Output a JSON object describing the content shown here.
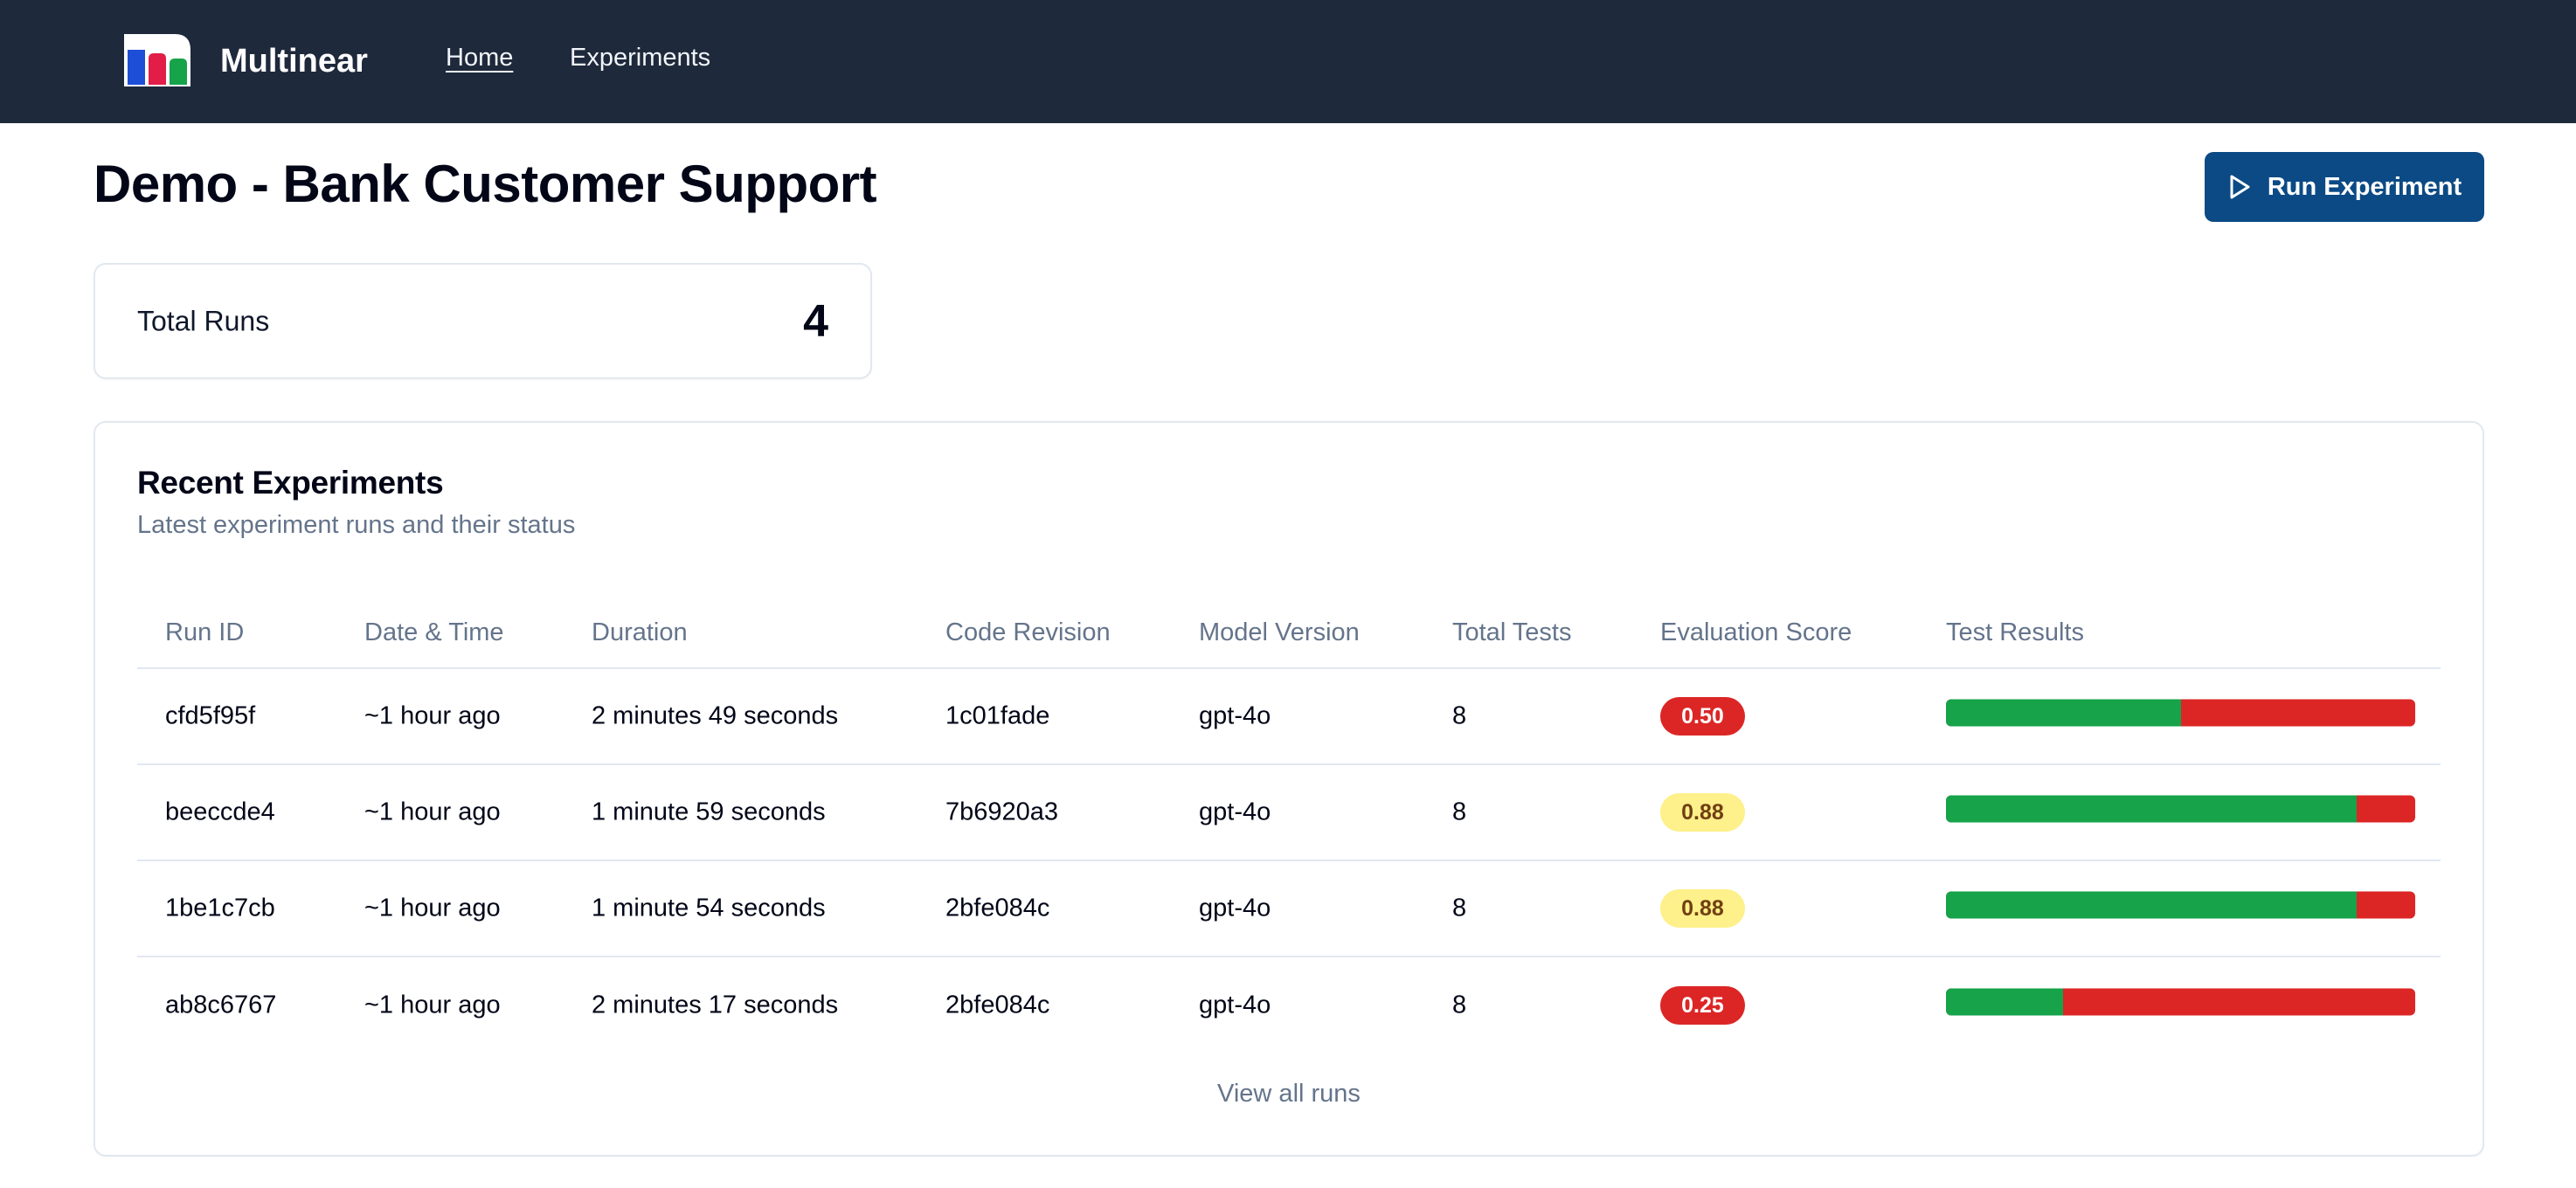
{
  "navbar": {
    "brand": "Multinear",
    "links": [
      {
        "label": "Home",
        "active": true
      },
      {
        "label": "Experiments",
        "active": false
      }
    ]
  },
  "page": {
    "title": "Demo - Bank Customer Support",
    "run_button": "Run Experiment"
  },
  "summary": {
    "total_runs_label": "Total Runs",
    "total_runs_value": "4"
  },
  "recent": {
    "title": "Recent Experiments",
    "subtitle": "Latest experiment runs and their status",
    "columns": [
      "Run ID",
      "Date & Time",
      "Duration",
      "Code Revision",
      "Model Version",
      "Total Tests",
      "Evaluation Score",
      "Test Results"
    ],
    "rows": [
      {
        "run_id": "cfd5f95f",
        "date": "~1 hour ago",
        "duration": "2 minutes 49 seconds",
        "revision": "1c01fade",
        "model": "gpt-4o",
        "total_tests": "8",
        "score": "0.50",
        "score_level": "red",
        "pass_fraction": 0.5
      },
      {
        "run_id": "beeccde4",
        "date": "~1 hour ago",
        "duration": "1 minute 59 seconds",
        "revision": "7b6920a3",
        "model": "gpt-4o",
        "total_tests": "8",
        "score": "0.88",
        "score_level": "yellow",
        "pass_fraction": 0.875
      },
      {
        "run_id": "1be1c7cb",
        "date": "~1 hour ago",
        "duration": "1 minute 54 seconds",
        "revision": "2bfe084c",
        "model": "gpt-4o",
        "total_tests": "8",
        "score": "0.88",
        "score_level": "yellow",
        "pass_fraction": 0.875
      },
      {
        "run_id": "ab8c6767",
        "date": "~1 hour ago",
        "duration": "2 minutes 17 seconds",
        "revision": "2bfe084c",
        "model": "gpt-4o",
        "total_tests": "8",
        "score": "0.25",
        "score_level": "red",
        "pass_fraction": 0.25
      }
    ],
    "view_all": "View all runs"
  },
  "colors": {
    "navbar": "#1e293b",
    "primary_button": "#0b4a85",
    "pass": "#16a34a",
    "fail": "#dc2626",
    "warning_badge": "#fef08a"
  },
  "icons": {
    "logo": "multinear-logo",
    "run_button": "play-icon"
  }
}
